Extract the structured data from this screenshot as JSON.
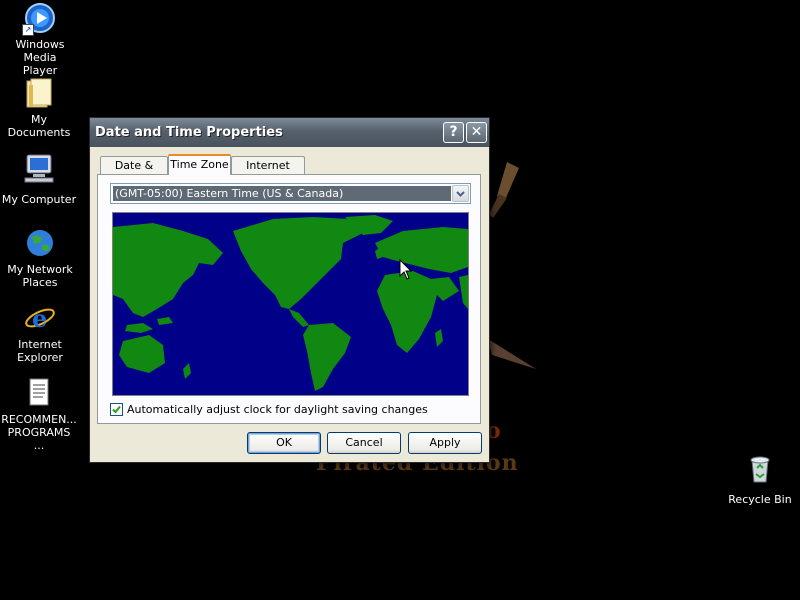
{
  "desktop": {
    "icons": [
      {
        "label_line1": "Windows Media",
        "label_line2": "Player",
        "icon": "windows-media-player-icon"
      },
      {
        "label_line1": "My Documents",
        "label_line2": "",
        "icon": "folder-icon"
      },
      {
        "label_line1": "My Computer",
        "label_line2": "",
        "icon": "computer-icon"
      },
      {
        "label_line1": "My Network",
        "label_line2": "Places",
        "icon": "network-globe-icon"
      },
      {
        "label_line1": "Internet",
        "label_line2": "Explorer",
        "icon": "internet-explorer-icon"
      },
      {
        "label_line1": "RECOMMEN...",
        "label_line2": "PROGRAMS ...",
        "icon": "text-document-icon"
      },
      {
        "label_line1": "Recycle Bin",
        "label_line2": "",
        "icon": "recycle-bin-icon"
      }
    ],
    "wallpaper_text": "Pirated Edition",
    "wallpaper_glyph": "o"
  },
  "dialog": {
    "title": "Date and Time Properties",
    "help_glyph": "?",
    "close_glyph": "✕",
    "tabs": [
      {
        "label": "Date & Time",
        "active": false
      },
      {
        "label": "Time Zone",
        "active": true
      },
      {
        "label": "Internet Time",
        "active": false
      }
    ],
    "timezone": {
      "selected": "(GMT-05:00) Eastern Time (US & Canada)"
    },
    "map": {
      "ocean_color": "#000088",
      "land_color": "#118811"
    },
    "daylight_checkbox": {
      "label": "Automatically adjust clock for daylight saving changes",
      "checked": true
    },
    "buttons": {
      "ok": "OK",
      "cancel": "Cancel",
      "apply": "Apply"
    }
  },
  "colors": {
    "titlebar": "#5c6774",
    "dialog_face": "#ece9d8",
    "selection": "#606a76"
  }
}
